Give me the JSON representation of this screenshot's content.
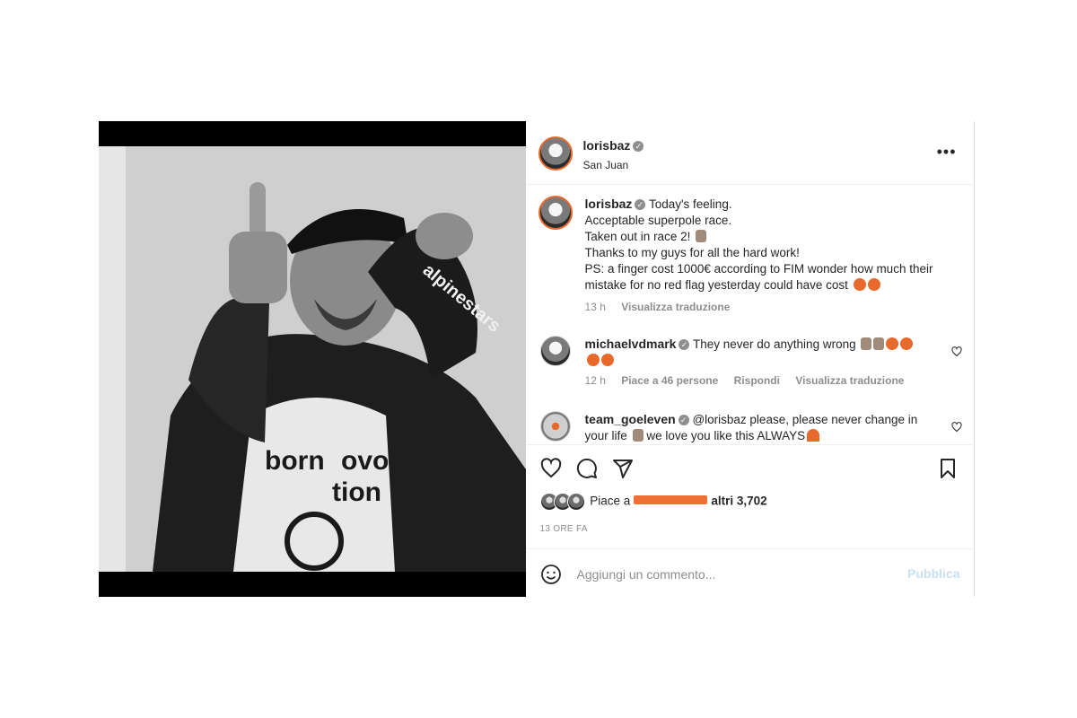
{
  "header": {
    "username": "lorisbaz",
    "location": "San Juan",
    "more_label": "•••"
  },
  "caption": {
    "username": "lorisbaz",
    "lines": [
      "Today's feeling.",
      "Acceptable superpole race.",
      "Taken out in race 2!",
      "Thanks to my guys for all the hard work!",
      "PS: a finger cost 1000€ according to FIM wonder how much their",
      "mistake for no red flag yesterday could have cost"
    ],
    "time": "13 h",
    "translate": "Visualizza traduzione"
  },
  "comments": [
    {
      "username": "michaelvdmark",
      "text": "They never do anything wrong",
      "time": "12 h",
      "likes": "Piace a 46 persone",
      "reply": "Rispondi",
      "translate": "Visualizza traduzione"
    },
    {
      "username": "team_goeleven",
      "text": "@lorisbaz please, please never change in",
      "text2": "your life",
      "text3": "we love you like this ALWAYS"
    }
  ],
  "likes": {
    "prefix": "Piace a",
    "suffix": "altri 3,702"
  },
  "time_ago": "13 ORE FA",
  "add_comment": {
    "placeholder": "Aggiungi un commento...",
    "publish": "Pubblica"
  },
  "colors": {
    "accent": "#e8692c",
    "redaction": "#ee6f35",
    "publish_disabled": "#c7e0f4"
  },
  "icons": [
    "heart-icon",
    "comment-icon",
    "share-icon",
    "bookmark-icon",
    "smile-icon",
    "verified-icon",
    "more-icon"
  ]
}
